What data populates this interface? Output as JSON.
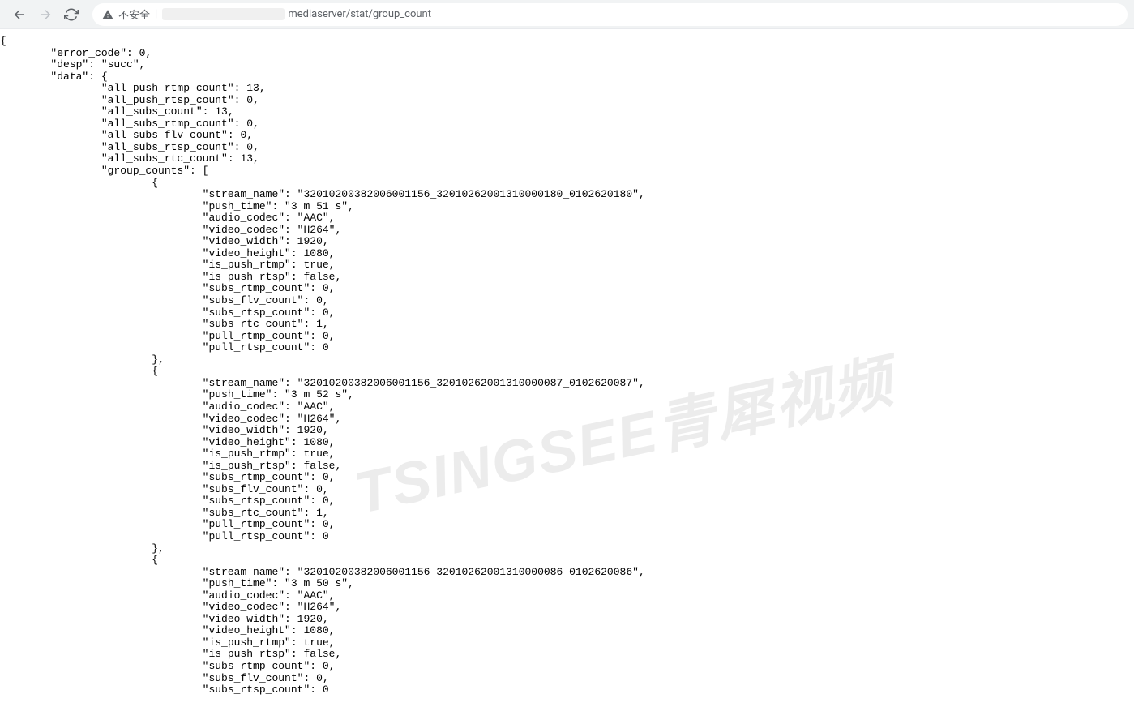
{
  "browser": {
    "security_label": "不安全",
    "url_visible": "mediaserver/stat/group_count"
  },
  "watermark": "TSINGSEE青犀视频",
  "json": {
    "error_code": 0,
    "desp": "succ",
    "data": {
      "all_push_rtmp_count": 13,
      "all_push_rtsp_count": 0,
      "all_subs_count": 13,
      "all_subs_rtmp_count": 0,
      "all_subs_flv_count": 0,
      "all_subs_rtsp_count": 0,
      "all_subs_rtc_count": 13,
      "group_counts": [
        {
          "stream_name": "32010200382006001156_32010262001310000180_0102620180",
          "push_time": "3 m 51 s",
          "audio_codec": "AAC",
          "video_codec": "H264",
          "video_width": 1920,
          "video_height": 1080,
          "is_push_rtmp": true,
          "is_push_rtsp": false,
          "subs_rtmp_count": 0,
          "subs_flv_count": 0,
          "subs_rtsp_count": 0,
          "subs_rtc_count": 1,
          "pull_rtmp_count": 0,
          "pull_rtsp_count": 0
        },
        {
          "stream_name": "32010200382006001156_32010262001310000087_0102620087",
          "push_time": "3 m 52 s",
          "audio_codec": "AAC",
          "video_codec": "H264",
          "video_width": 1920,
          "video_height": 1080,
          "is_push_rtmp": true,
          "is_push_rtsp": false,
          "subs_rtmp_count": 0,
          "subs_flv_count": 0,
          "subs_rtsp_count": 0,
          "subs_rtc_count": 1,
          "pull_rtmp_count": 0,
          "pull_rtsp_count": 0
        },
        {
          "stream_name": "32010200382006001156_32010262001310000086_0102620086",
          "push_time": "3 m 50 s",
          "audio_codec": "AAC",
          "video_codec": "H264",
          "video_width": 1920,
          "video_height": 1080,
          "is_push_rtmp": true,
          "is_push_rtsp": false,
          "subs_rtmp_count": 0,
          "subs_flv_count": 0,
          "subs_rtsp_count": 0
        }
      ]
    }
  }
}
